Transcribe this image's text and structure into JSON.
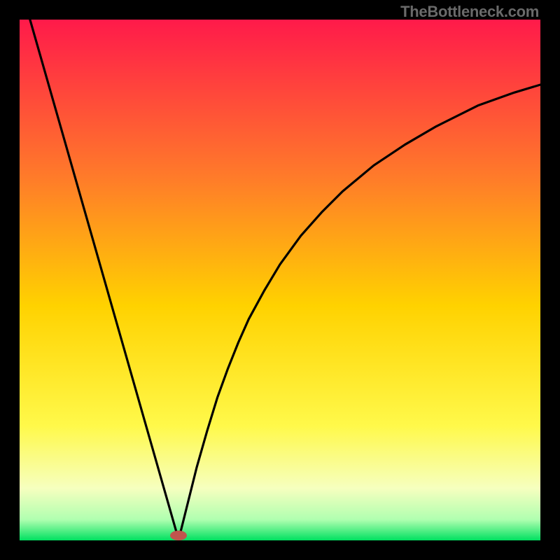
{
  "attribution": "TheBottleneck.com",
  "colors": {
    "frame": "#000000",
    "gradient_top": "#ff1a4a",
    "gradient_mid_upper": "#ff8a2a",
    "gradient_mid": "#ffd200",
    "gradient_low": "#ffff66",
    "gradient_lower": "#f0ffcc",
    "gradient_bottom": "#00e060",
    "curve": "#000000",
    "marker": "#c1554d"
  },
  "chart_data": {
    "type": "line",
    "title": "",
    "xlabel": "",
    "ylabel": "",
    "xlim": [
      0,
      100
    ],
    "ylim": [
      0,
      100
    ],
    "marker": {
      "x": 30.5,
      "y": 1
    },
    "series": [
      {
        "name": "bottleneck-curve",
        "x": [
          2,
          4,
          6,
          8,
          10,
          12,
          14,
          16,
          18,
          20,
          22,
          24,
          26,
          28,
          29,
          30,
          30.5,
          31,
          32,
          33,
          34,
          36,
          38,
          40,
          42,
          44,
          47,
          50,
          54,
          58,
          62,
          68,
          74,
          80,
          88,
          95,
          100
        ],
        "y": [
          100,
          93,
          86,
          79,
          72,
          65,
          58,
          51,
          44,
          37,
          30,
          23,
          16,
          9,
          5.5,
          2,
          0.5,
          2,
          6,
          10,
          14,
          21,
          27.5,
          33,
          38,
          42.5,
          48,
          53,
          58.5,
          63,
          67,
          72,
          76,
          79.5,
          83.5,
          86,
          87.5
        ]
      }
    ]
  }
}
